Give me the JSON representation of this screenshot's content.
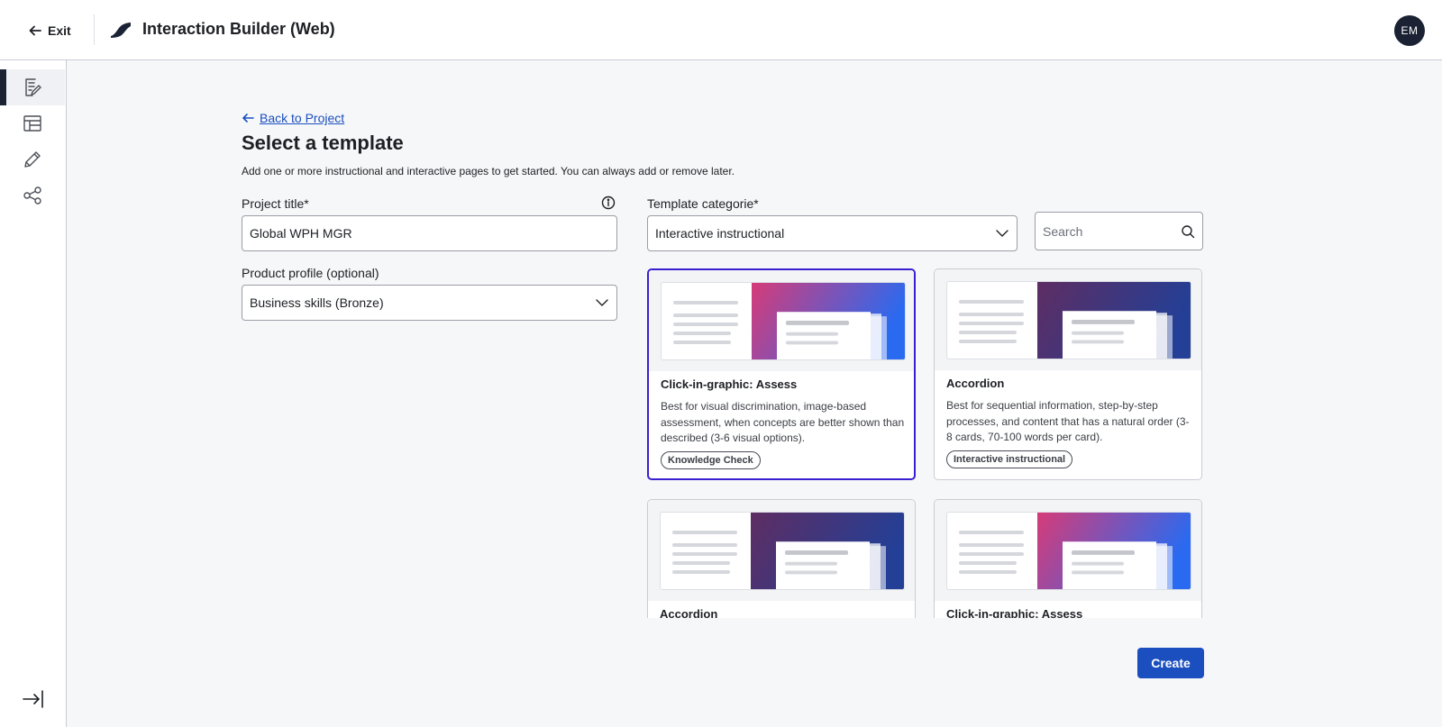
{
  "header": {
    "exit_label": "Exit",
    "app_title": "Interaction Builder (Web)",
    "avatar_initials": "EM"
  },
  "sidebar": {
    "items": [
      {
        "icon": "edit-document-icon",
        "active": true
      },
      {
        "icon": "layout-icon",
        "active": false
      },
      {
        "icon": "pencil-icon",
        "active": false
      },
      {
        "icon": "share-nodes-icon",
        "active": false
      }
    ],
    "collapse_icon": "expand-sidebar-icon"
  },
  "main": {
    "back_link": "Back to Project",
    "title": "Select a template",
    "description": "Add one or more instructional and interactive pages to get started. You can always add or remove later.",
    "project_title_label": "Project title*",
    "project_title_value": "Global WPH MGR",
    "product_profile_label": "Product profile (optional)",
    "product_profile_value": "Business skills (Bronze)",
    "template_category_label": "Template categorie*",
    "template_category_value": "Interactive instructional",
    "search_placeholder": "Search"
  },
  "templates": [
    {
      "title": "Click-in-graphic: Assess",
      "description": "Best for visual discrimination, image-based assessment, when concepts are better shown than described (3-6 visual options).",
      "badge": "Knowledge Check",
      "selected": true,
      "gradient": [
        "#d63b78",
        "#2a6af0"
      ]
    },
    {
      "title": "Accordion",
      "description": "Best for sequential information, step-by-step processes, and content that has a natural order (3-8 cards, 70-100 words per card).",
      "badge": "Interactive instructional",
      "selected": false,
      "gradient": [
        "#5e2d62",
        "#233f96"
      ]
    },
    {
      "title": "Accordion",
      "description": "",
      "badge": "",
      "selected": false,
      "gradient": [
        "#5e2d62",
        "#233f96"
      ]
    },
    {
      "title": "Click-in-graphic: Assess",
      "description": "",
      "badge": "",
      "selected": false,
      "gradient": [
        "#d63b78",
        "#2a6af0"
      ]
    }
  ],
  "footer": {
    "create_label": "Create"
  },
  "colors": {
    "primary": "#1b4fbf",
    "selected_border": "#3a1fd1",
    "sidebar_active": "#1a2233"
  }
}
